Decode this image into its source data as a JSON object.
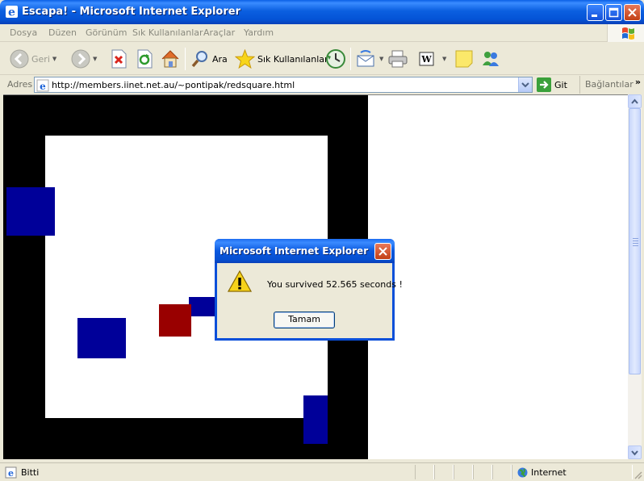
{
  "window": {
    "title": "Escapa! - Microsoft Internet Explorer"
  },
  "menu": {
    "items": [
      "Dosya",
      "Düzen",
      "Görünüm",
      "Sık Kullanılanlar",
      "Araçlar",
      "Yardım"
    ]
  },
  "toolbar": {
    "back_label": "Geri",
    "search_label": "Ara",
    "favorites_label": "Sık Kullanılanlar"
  },
  "address": {
    "label": "Adres",
    "url": "http://members.iinet.net.au/~pontipak/redsquare.html",
    "go_label": "Git",
    "links_label": "Bağlantılar"
  },
  "dialog": {
    "title": "Microsoft Internet Explorer",
    "message": "You survived 52.565 seconds !",
    "ok_label": "Tamam"
  },
  "status": {
    "text": "Bitti",
    "zone": "Internet"
  },
  "colors": {
    "frame": "#000000",
    "blocks": "#000099",
    "player": "#990000",
    "xp_blue": "#0a5fe6"
  }
}
